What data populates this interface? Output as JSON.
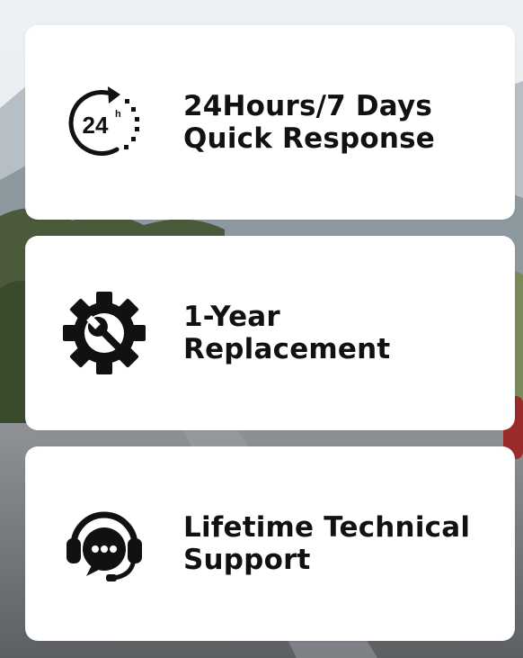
{
  "features": [
    {
      "icon": "24-hours-icon",
      "icon_text": "24",
      "icon_superscript": "h",
      "lines": [
        "24Hours/7 Days",
        "Quick Response"
      ]
    },
    {
      "icon": "gear-wrench-icon",
      "lines": [
        "1-Year Replacement"
      ]
    },
    {
      "icon": "headset-chat-icon",
      "lines": [
        "Lifetime Technical",
        "Support"
      ]
    }
  ],
  "colors": {
    "card": "#ffffff",
    "text": "#111111",
    "icon": "#111111"
  }
}
